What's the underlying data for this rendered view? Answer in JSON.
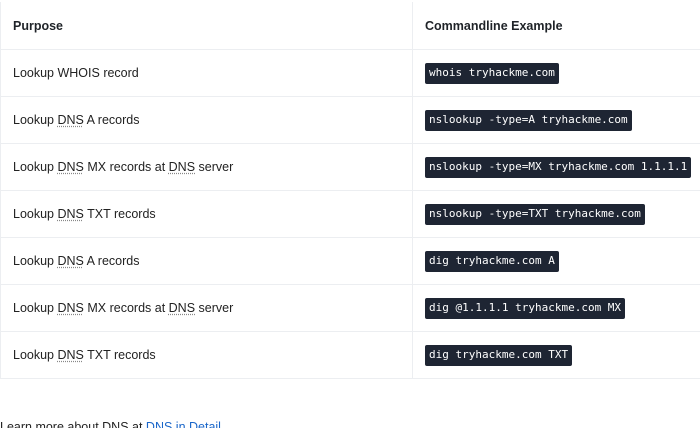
{
  "table": {
    "headers": [
      "Purpose",
      "Commandline Example"
    ],
    "rows": [
      {
        "purpose_pre": "Lookup WHOIS record",
        "abbr1": "",
        "purpose_mid": "",
        "abbr2": "",
        "purpose_post": "",
        "command": "whois tryhackme.com"
      },
      {
        "purpose_pre": "Lookup ",
        "abbr1": "DNS",
        "purpose_mid": " A records",
        "abbr2": "",
        "purpose_post": "",
        "command": "nslookup -type=A tryhackme.com"
      },
      {
        "purpose_pre": "Lookup ",
        "abbr1": "DNS",
        "purpose_mid": " MX records at ",
        "abbr2": "DNS",
        "purpose_post": " server",
        "command": "nslookup -type=MX tryhackme.com 1.1.1.1"
      },
      {
        "purpose_pre": "Lookup ",
        "abbr1": "DNS",
        "purpose_mid": " TXT records",
        "abbr2": "",
        "purpose_post": "",
        "command": "nslookup -type=TXT tryhackme.com"
      },
      {
        "purpose_pre": "Lookup ",
        "abbr1": "DNS",
        "purpose_mid": " A records",
        "abbr2": "",
        "purpose_post": "",
        "command": "dig tryhackme.com A"
      },
      {
        "purpose_pre": "Lookup ",
        "abbr1": "DNS",
        "purpose_mid": " MX records at ",
        "abbr2": "DNS",
        "purpose_post": " server",
        "command": "dig @1.1.1.1 tryhackme.com MX"
      },
      {
        "purpose_pre": "Lookup ",
        "abbr1": "DNS",
        "purpose_mid": " TXT records",
        "abbr2": "",
        "purpose_post": "",
        "command": "dig tryhackme.com TXT"
      }
    ]
  },
  "footer": {
    "text": "Learn more about DNS at ",
    "link": "DNS in Detail"
  }
}
